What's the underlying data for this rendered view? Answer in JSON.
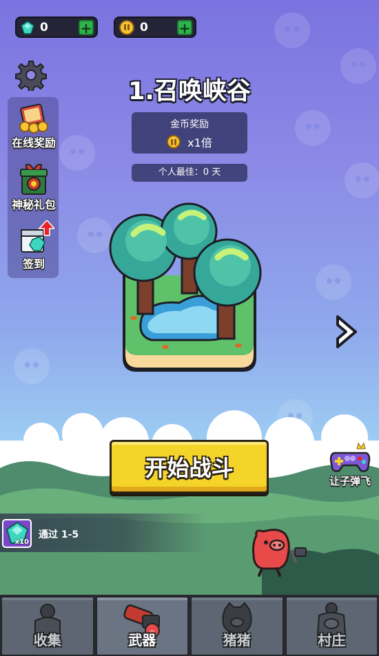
{
  "resources": {
    "gems": {
      "value": "0",
      "icon": "gem-icon",
      "add_icon": "plus-icon"
    },
    "coins": {
      "value": "0",
      "icon": "coin-icon",
      "add_icon": "plus-icon"
    }
  },
  "settings": {
    "icon": "gear-icon"
  },
  "side_menu": [
    {
      "label": "在线奖励",
      "icon": "treasure-chest-icon"
    },
    {
      "label": "神秘礼包",
      "icon": "gift-box-icon"
    },
    {
      "label": "签到",
      "icon": "calendar-icon"
    }
  ],
  "level": {
    "title": "1.召唤峡谷",
    "reward_title": "金币奖励",
    "reward_multiplier": "x1倍",
    "best_record": "个人最佳：0 天"
  },
  "start_button": {
    "label": "开始战斗"
  },
  "side_right": {
    "label": "让子弹飞",
    "icon": "gamepad-icon"
  },
  "task": {
    "text": "通过 1-5",
    "reward_count": "x10",
    "reward_icon": "gem-icon"
  },
  "bottom_nav": [
    {
      "label": "收集",
      "icon": "collection-icon",
      "active": false
    },
    {
      "label": "武器",
      "icon": "cannon-icon",
      "active": true
    },
    {
      "label": "猪猪",
      "icon": "pig-icon",
      "active": false
    },
    {
      "label": "村庄",
      "icon": "village-icon",
      "active": false
    }
  ],
  "colors": {
    "accent_yellow": "#f5d42a",
    "plus_green": "#2fb34c",
    "sky_top": "#7a73e0",
    "gem_cyan": "#3fd6c0",
    "pig_red": "#e84a4a"
  }
}
